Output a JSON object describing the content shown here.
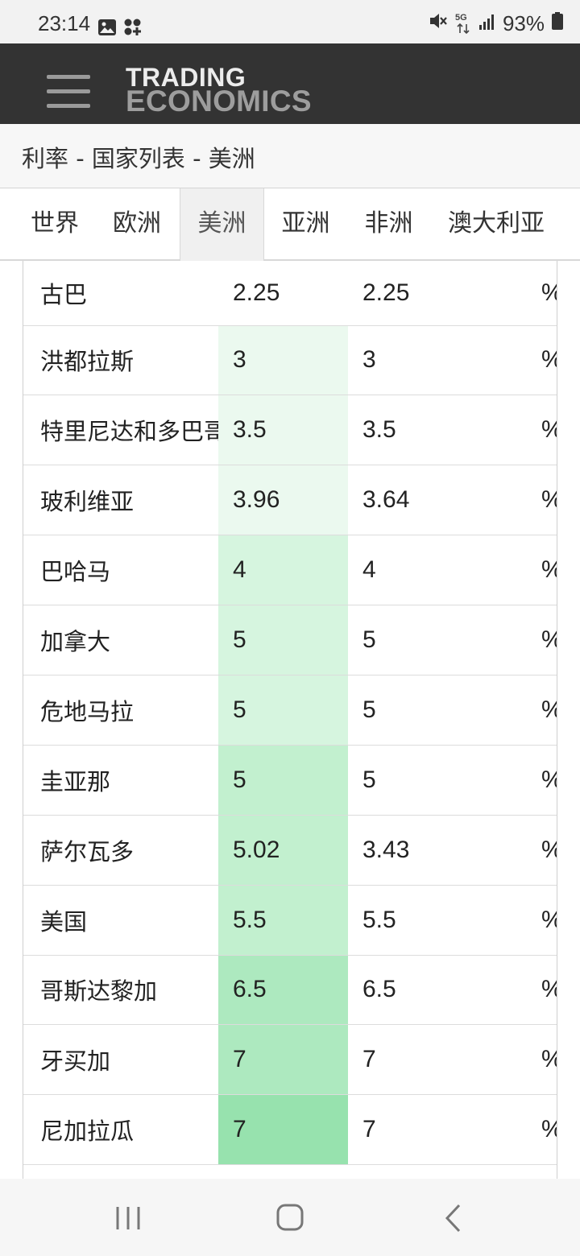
{
  "status_bar": {
    "time": "23:14",
    "battery": "93%",
    "network": "5G"
  },
  "header": {
    "logo_line1": "TRADING",
    "logo_line2": "ECONOMICS"
  },
  "breadcrumb": "利率 - 国家列表 - 美洲",
  "tabs": [
    {
      "label": "世界",
      "active": false
    },
    {
      "label": "欧洲",
      "active": false
    },
    {
      "label": "美洲",
      "active": true
    },
    {
      "label": "亚洲",
      "active": false
    },
    {
      "label": "非洲",
      "active": false
    },
    {
      "label": "澳大利亚",
      "active": false
    }
  ],
  "colors": {
    "header_bg": "#333333",
    "highlight_scale": [
      "#ffffff",
      "#ebf9ef",
      "#d6f5df",
      "#c2f0cf",
      "#ade9bf",
      "#97e2ae"
    ]
  },
  "rows": [
    {
      "country": "古巴",
      "last": "2.25",
      "previous": "2.25",
      "unit": "%",
      "shade": 0
    },
    {
      "country": "洪都拉斯",
      "last": "3",
      "previous": "3",
      "unit": "%",
      "shade": 1
    },
    {
      "country": "特里尼达和多巴哥",
      "last": "3.5",
      "previous": "3.5",
      "unit": "%",
      "shade": 1
    },
    {
      "country": "玻利维亚",
      "last": "3.96",
      "previous": "3.64",
      "unit": "%",
      "shade": 1
    },
    {
      "country": "巴哈马",
      "last": "4",
      "previous": "4",
      "unit": "%",
      "shade": 2
    },
    {
      "country": "加拿大",
      "last": "5",
      "previous": "5",
      "unit": "%",
      "shade": 2
    },
    {
      "country": "危地马拉",
      "last": "5",
      "previous": "5",
      "unit": "%",
      "shade": 2
    },
    {
      "country": "圭亚那",
      "last": "5",
      "previous": "5",
      "unit": "%",
      "shade": 3
    },
    {
      "country": "萨尔瓦多",
      "last": "5.02",
      "previous": "3.43",
      "unit": "%",
      "shade": 3
    },
    {
      "country": "美国",
      "last": "5.5",
      "previous": "5.5",
      "unit": "%",
      "shade": 3
    },
    {
      "country": "哥斯达黎加",
      "last": "6.5",
      "previous": "6.5",
      "unit": "%",
      "shade": 4
    },
    {
      "country": "牙买加",
      "last": "7",
      "previous": "7",
      "unit": "%",
      "shade": 4
    },
    {
      "country": "尼加拉瓜",
      "last": "7",
      "previous": "7",
      "unit": "%",
      "shade": 5
    }
  ]
}
